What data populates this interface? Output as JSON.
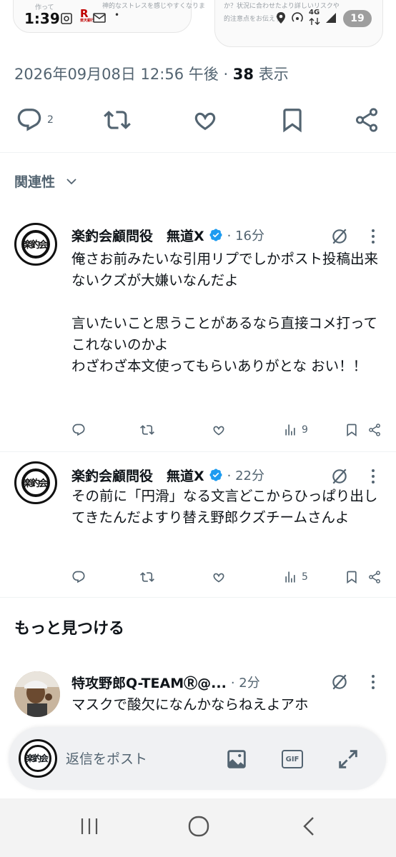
{
  "status": {
    "time": "1:39",
    "network": "4G",
    "battery": "19",
    "carrier_logo": "楽天銀行",
    "notification_peek_left_1": "作って",
    "notification_peek_left_2": "神的なストレスを感じやすくなりま",
    "notification_peek_right_1": "か？状況に合わせたより詳しいリスクや",
    "notification_peek_right_2": "的注意点をお伝えす"
  },
  "post": {
    "timestamp": "2026年09月08日 12:56 午後",
    "separator": " · ",
    "views_count": "38",
    "views_label": " 表示",
    "reply_count": "2"
  },
  "related": {
    "label": "関連性"
  },
  "replies": [
    {
      "name": "楽釣会顧問役　無道X",
      "meta": "· 16分",
      "avatar_text": "楽釣会",
      "text": "俺さお前みたいな引用リプでしかポスト投稿出来ないクズが大嫌いなんだよ\n\n言いたいこと思うことがあるなら直接コメ打ってこれないのかよ\nわざわざ本文使ってもらいありがとな おい！！",
      "views": "9"
    },
    {
      "name": "楽釣会顧問役　無道X",
      "meta": "· 22分",
      "avatar_text": "楽釣会",
      "text": "その前に「円滑」なる文言どこからひっぱり出してきたんだよすり替え野郎クズチームさんよ",
      "views": "5"
    }
  ],
  "discover": {
    "heading": "もっと見つける",
    "item": {
      "name": "特攻野郎Q-TEAMⓇ@...",
      "meta": "· 2分",
      "text": "マスクで酸欠になんかならねえよアホ"
    }
  },
  "reply_bar": {
    "placeholder": "返信をポスト",
    "avatar_text": "楽釣会",
    "gif_label": "GIF"
  },
  "colors": {
    "verified": "#1d9bf0",
    "secondary_text": "#536471",
    "primary_text": "#0f1419"
  },
  "icons": [
    "reply-icon",
    "repost-icon",
    "like-icon",
    "bookmark-icon",
    "share-icon",
    "chevron-down-icon",
    "verified-icon",
    "grok-icon",
    "more-icon",
    "views-icon",
    "image-icon",
    "gif-icon",
    "expand-icon",
    "recents-icon",
    "home-icon",
    "back-icon"
  ]
}
